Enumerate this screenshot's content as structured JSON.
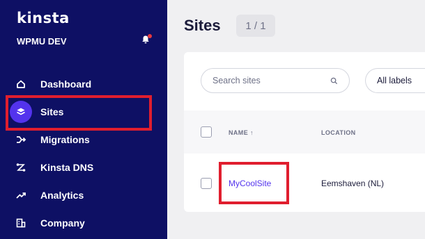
{
  "sidebar": {
    "logo": "kinsta",
    "org_name": "WPMU DEV",
    "items": [
      {
        "label": "Dashboard",
        "icon": "home-icon"
      },
      {
        "label": "Sites",
        "icon": "layers-icon",
        "active": true
      },
      {
        "label": "Migrations",
        "icon": "migrations-icon"
      },
      {
        "label": "Kinsta DNS",
        "icon": "dns-icon"
      },
      {
        "label": "Analytics",
        "icon": "analytics-icon"
      },
      {
        "label": "Company",
        "icon": "company-icon"
      }
    ]
  },
  "header": {
    "title": "Sites",
    "count": "1 / 1"
  },
  "toolbar": {
    "search_placeholder": "Search sites",
    "labels_filter": "All labels"
  },
  "table": {
    "columns": [
      "NAME ↑",
      "LOCATION"
    ],
    "rows": [
      {
        "name": "MyCoolSite",
        "location": "Eemshaven (NL)"
      }
    ]
  },
  "colors": {
    "sidebar_bg": "#0e1064",
    "accent": "#5333ed",
    "highlight": "#e01e2e",
    "notification": "#e6393f"
  }
}
